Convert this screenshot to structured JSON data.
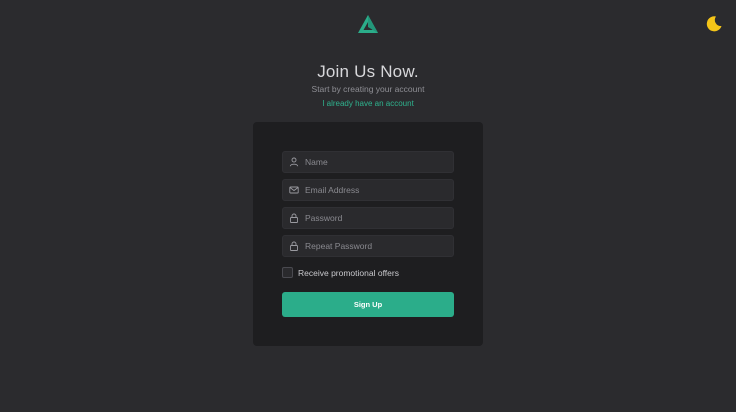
{
  "header": {
    "logo_icon": "triangle-logo-icon",
    "theme_toggle_icon": "moon-icon"
  },
  "intro": {
    "title": "Join Us Now.",
    "subtitle": "Start by creating your account",
    "login_link": "I already have an account"
  },
  "form": {
    "name_placeholder": "Name",
    "email_placeholder": "Email Address",
    "password_placeholder": "Password",
    "repeat_password_placeholder": "Repeat Password",
    "promo_label": "Receive promotional offers",
    "promo_checked": false,
    "submit_label": "Sign Up"
  },
  "colors": {
    "background": "#2b2b2e",
    "card": "#1e1e20",
    "accent": "#2bad8a",
    "theme_icon": "#f5c518"
  }
}
